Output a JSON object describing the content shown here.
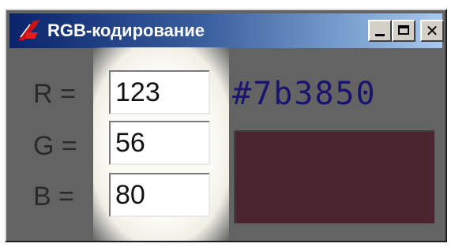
{
  "window": {
    "title": "RGB-кодирование",
    "close_glyph": "✕"
  },
  "fields": {
    "r_label": "R =",
    "g_label": "G =",
    "b_label": "B =",
    "r_value": "123",
    "g_value": "56",
    "b_value": "80"
  },
  "output": {
    "hex": "#7b3850",
    "swatch_color": "#4a2530"
  },
  "icons": {
    "app": "tk-feather-icon",
    "minimize": "minimize-icon",
    "maximize": "maximize-icon",
    "close": "close-icon"
  },
  "colors": {
    "titlebar_start": "#0a246a",
    "titlebar_end": "#a6caf0",
    "hex_text": "#1a1470",
    "window_bg": "#636363"
  }
}
